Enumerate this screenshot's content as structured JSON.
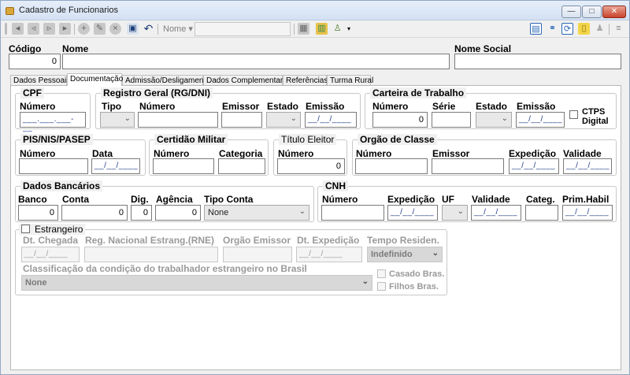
{
  "window": {
    "title": "Cadastro de Funcionarios",
    "min": "—",
    "max": "□",
    "close": "✕"
  },
  "toolbar": {
    "nome_dropdown": "Nome ▾",
    "search_value": ""
  },
  "header": {
    "codigo_label": "Código",
    "codigo_value": "0",
    "nome_label": "Nome",
    "nome_value": "",
    "nome_social_label": "Nome Social",
    "nome_social_value": ""
  },
  "tabs": [
    "Dados Pessoais",
    "Documentação",
    "Admissão/Desligamento",
    "Dados Complementares",
    "Referências",
    "Turma Rural"
  ],
  "cpf": {
    "title": "CPF",
    "numero_label": "Número",
    "numero_value": "___.___.___-__"
  },
  "rg": {
    "title": "Registro Geral (RG/DNI)",
    "tipo_label": "Tipo",
    "numero_label": "Número",
    "emissor_label": "Emissor",
    "estado_label": "Estado",
    "emissao_label": "Emissão",
    "emissao_value": "__/__/____"
  },
  "ctps": {
    "title": "Carteira de Trabalho",
    "numero_label": "Número",
    "numero_value": "0",
    "serie_label": "Série",
    "estado_label": "Estado",
    "emissao_label": "Emissão",
    "emissao_value": "__/__/____",
    "digital_label1": "CTPS",
    "digital_label2": "Digital"
  },
  "pis": {
    "title": "PIS/NIS/PASEP",
    "numero_label": "Número",
    "data_label": "Data",
    "data_value": "__/__/____"
  },
  "militar": {
    "title": "Certidão Militar",
    "numero_label": "Número",
    "categoria_label": "Categoria"
  },
  "eleitor": {
    "title": "Título Eleitor",
    "numero_label": "Número",
    "numero_value": "0"
  },
  "orgao": {
    "title": "Orgão de Classe",
    "numero_label": "Número",
    "emissor_label": "Emissor",
    "expedicao_label": "Expedição",
    "expedicao_value": "__/__/____",
    "validade_label": "Validade",
    "validade_value": "__/__/____"
  },
  "banco": {
    "title": "Dados Bancários",
    "banco_label": "Banco",
    "banco_value": "0",
    "conta_label": "Conta",
    "conta_value": "0",
    "dig_label": "Dig.",
    "dig_value": "0",
    "agencia_label": "Agência",
    "agencia_value": "0",
    "tipo_label": "Tipo Conta",
    "tipo_value": "None"
  },
  "cnh": {
    "title": "CNH",
    "numero_label": "Número",
    "expedicao_label": "Expedição",
    "expedicao_value": "__/__/____",
    "uf_label": "UF",
    "validade_label": "Validade",
    "validade_value": "__/__/____",
    "categ_label": "Categ.",
    "prim_label": "Prim.Habil",
    "prim_value": "__/__/____"
  },
  "estrangeiro": {
    "title": "Estrangeiro",
    "chegada_label": "Dt. Chegada",
    "chegada_value": "__/__/____",
    "rne_label": "Reg. Nacional Estrang.(RNE)",
    "orgao_label": "Orgão Emissor",
    "expedicao_label": "Dt. Expedição",
    "expedicao_value": "__/__/____",
    "tempo_label": "Tempo Residen.",
    "tempo_value": "Indefinido",
    "class_label": "Classificação da condição do trabalhador estrangeiro no Brasil",
    "class_value": "None",
    "casado_label": "Casado Bras.",
    "filhos_label": "Filhos Bras."
  }
}
